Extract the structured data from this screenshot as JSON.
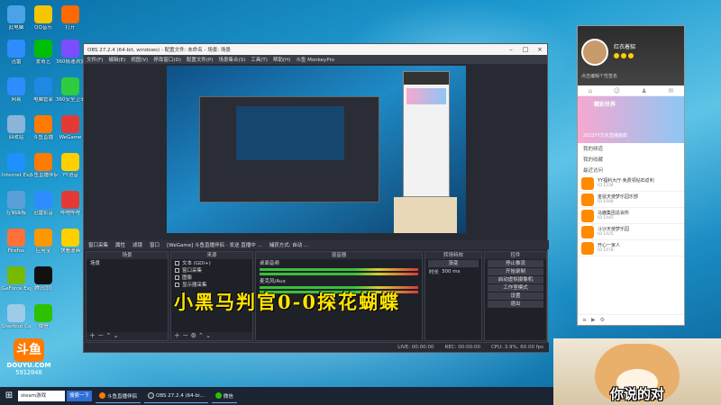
{
  "desktop": {
    "icons": [
      {
        "label": "此电脑",
        "color": "#4aa3e6"
      },
      {
        "label": "QQ音乐",
        "color": "#f3c600"
      },
      {
        "label": "打开",
        "color": "#ff6a00"
      },
      {
        "label": "迅雷",
        "color": "#2f8cff"
      },
      {
        "label": "爱奇艺",
        "color": "#00be06"
      },
      {
        "label": "360极速浏览器",
        "color": "#7c4dff"
      },
      {
        "label": "网易",
        "color": "#2f8cff"
      },
      {
        "label": "电脑管家",
        "color": "#1e88e5"
      },
      {
        "label": "360安全卫士",
        "color": "#2ecc40"
      },
      {
        "label": "回收站",
        "color": "#8ab4d8"
      },
      {
        "label": "斗鱼直播",
        "color": "#ff7a00"
      },
      {
        "label": "WeGame",
        "color": "#e53935"
      },
      {
        "label": "Internet Explorer",
        "color": "#1e90ff"
      },
      {
        "label": "斗鱼直播伴侣",
        "color": "#ff7a00"
      },
      {
        "label": "YY语音",
        "color": "#ffd000"
      },
      {
        "label": "控制面板",
        "color": "#5aa0d8"
      },
      {
        "label": "迅雷影音",
        "color": "#2f8cff"
      },
      {
        "label": "哔哩哔哩",
        "color": "#e53935"
      },
      {
        "label": "Firefox",
        "color": "#ff7139"
      },
      {
        "label": "应用宝",
        "color": "#ff9800"
      },
      {
        "label": "快看漫画",
        "color": "#ffd000"
      },
      {
        "label": "GeForce Experience",
        "color": "#76b900"
      },
      {
        "label": "腾讯QQ",
        "color": "#111111"
      },
      {
        "label": "Shortcut Core",
        "color": "#9ecbe8"
      },
      {
        "label": "微信",
        "color": "#2dc100"
      }
    ],
    "douyu_logo": {
      "mark": "斗鱼",
      "brand": "DOUYU.COM",
      "room": "5912040"
    }
  },
  "obs": {
    "title": "OBS 27.2.4 (64-bit, windows) - 配置文件: 未命名 - 场景: 场景",
    "menu": [
      "文件(F)",
      "编辑(E)",
      "视图(V)",
      "停靠窗口(D)",
      "配置文件(P)",
      "场景集合(S)",
      "工具(T)",
      "帮助(H)",
      "斗鱼 MonkeyPro"
    ],
    "control_bar": [
      "窗口采集",
      "属性",
      "滤镜",
      "窗口",
      "[WeGame] 斗鱼直播伴侣 - 发送 直播中 ...",
      "捕获方式: 自动 ..."
    ],
    "docks": {
      "scenes": {
        "title": "场景",
        "items": [
          "场景"
        ]
      },
      "sources": {
        "title": "来源",
        "items": [
          "文本 (GDI+)",
          "窗口采集",
          "图像",
          "显示器采集"
        ]
      },
      "mixer": {
        "title": "混音器",
        "tracks": [
          "桌面音频",
          "麦克风/Aux"
        ]
      },
      "transitions": {
        "title": "转场特效",
        "type": "渐变",
        "duration_label": "时长",
        "duration": "300 ms"
      },
      "controls": {
        "title": "控件",
        "buttons": [
          "停止推流",
          "开始录制",
          "启动虚拟摄像机",
          "工作室模式",
          "设置",
          "退出"
        ]
      }
    },
    "status": {
      "live": "LIVE: 00:00:00",
      "rec": "REC: 00:00:00",
      "cpu": "CPU: 3.9%, 60.00 fps"
    },
    "overlay_text": "小黑马判官0-0探花蝴蝶"
  },
  "yy": {
    "nickname": "红衣着貂",
    "signature": "点击编辑个性签名",
    "banner_title": "精彩世界",
    "banner_sub": "2022YY文化直播盛典",
    "sections": [
      "我的频道",
      "我的收藏",
      "最近访问"
    ],
    "items": [
      {
        "title": "YY福利大厅·免费领钻石返利",
        "sub": "ID 1234"
      },
      {
        "title": "金鼠天使梦乐园乐部",
        "sub": "ID 1048"
      },
      {
        "title": "马鹿集团总会所",
        "sub": "ID 1445"
      },
      {
        "title": "斗沙天使梦乐园",
        "sub": "ID 1425"
      },
      {
        "title": "开心一家人",
        "sub": "ID 1478"
      }
    ]
  },
  "doge_caption": "你说的对",
  "taskbar": {
    "start": "⊞",
    "search": "steam游戏",
    "search_btn": "搜索一下",
    "apps": [
      {
        "label": "斗鱼直播伴侣",
        "color": "#ff7a00"
      },
      {
        "label": "OBS 27.2.4 (64-bi...",
        "color": "#333333"
      },
      {
        "label": "微信",
        "color": "#2dc100"
      }
    ]
  }
}
